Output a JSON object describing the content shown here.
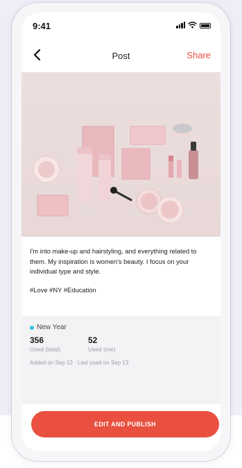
{
  "status_bar": {
    "time": "9:41"
  },
  "nav": {
    "title": "Post",
    "share_label": "Share"
  },
  "post": {
    "caption": "I'm into make-up and hairstyling, and everything related to them. My inspiration is women's beauty. I focus on your individual type and style.",
    "hashtags": "#Love #NY #Education"
  },
  "meta": {
    "tag": "New Year",
    "tag_color": "#2fc4df",
    "stats": [
      {
        "value": "356",
        "label": "Used (total)"
      },
      {
        "value": "52",
        "label": "Used (me)"
      }
    ],
    "added_text": "Added on Sep 12 · Last used on Sep 13"
  },
  "actions": {
    "publish_label": "EDIT AND PUBLISH"
  },
  "colors": {
    "accent": "#e9503f",
    "photo_bg": "#ecdede"
  }
}
